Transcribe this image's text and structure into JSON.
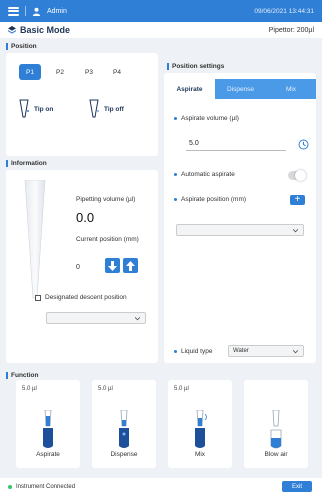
{
  "topbar": {
    "user": "Admin",
    "datetime": "09/06/2021 13:44:31"
  },
  "mode": {
    "title": "Basic Mode",
    "pipettor": "Pipettor: 200µl"
  },
  "position": {
    "title": "Position",
    "buttons": [
      "P1",
      "P2",
      "P3",
      "P4"
    ],
    "selected": "P1",
    "tip_on": "Tip on",
    "tip_off": "Tip off"
  },
  "information": {
    "title": "Information",
    "pipetting_volume_label": "Pipetting volume (µl)",
    "pipetting_volume_value": "0.0",
    "current_position_label": "Current position (mm)",
    "current_position_value": "0",
    "descent_label": "Designated descent position",
    "descent_select_value": ""
  },
  "position_settings": {
    "title": "Position settings",
    "tabs": [
      "Aspirate",
      "Dispense",
      "Mix"
    ],
    "active_tab": "Aspirate",
    "aspirate_volume_label": "Aspirate volume (µl)",
    "aspirate_volume_value": "5.0",
    "automatic_aspirate_label": "Automatic aspirate",
    "aspirate_position_label": "Aspirate position (mm)",
    "aspirate_position_value": "",
    "liquid_type_label": "Liquid type",
    "liquid_type_value": "Water"
  },
  "function": {
    "title": "Function",
    "items": [
      {
        "volume": "5.0 µl",
        "label": "Aspirate"
      },
      {
        "volume": "5.0 µl",
        "label": "Dispense"
      },
      {
        "volume": "5.0 µl",
        "label": "Mix"
      },
      {
        "volume": "",
        "label": "Blow air"
      }
    ]
  },
  "status": {
    "text": "Instrument Connected",
    "exit_label": "Exit"
  },
  "colors": {
    "primary": "#2f7fd6",
    "connected": "#3ac46a"
  }
}
